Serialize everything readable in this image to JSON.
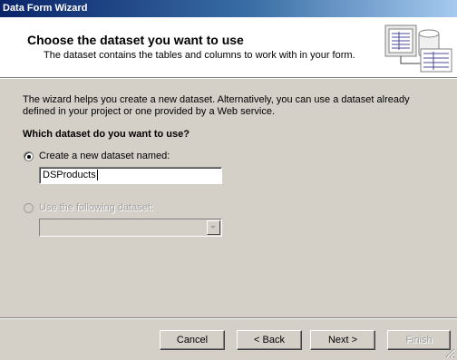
{
  "window": {
    "title": "Data Form Wizard"
  },
  "header": {
    "title": "Choose the dataset you want to use",
    "subtitle": "The dataset contains the tables and columns to work with in your form.",
    "graphic_icon": "dataset-tables-icon"
  },
  "body": {
    "intro_line1": "The wizard helps you create a new dataset. Alternatively, you can use a dataset already",
    "intro_line2": "defined in your project or one provided by a Web service.",
    "question": "Which dataset do you want to use?",
    "option_create": {
      "label": "Create a new dataset named:",
      "selected": true
    },
    "dataset_name_value": "DSProducts",
    "option_existing": {
      "label": "Use the following dataset:",
      "selected": false,
      "enabled": false
    },
    "existing_dataset_value": ""
  },
  "buttons": {
    "cancel": "Cancel",
    "back": "< Back",
    "next": "Next >",
    "finish": "Finish"
  },
  "colors": {
    "titlebar_start": "#0a246a",
    "titlebar_end": "#a6caf0",
    "dialog_face": "#d4d0c8",
    "disabled_text": "#a0a0a0"
  }
}
